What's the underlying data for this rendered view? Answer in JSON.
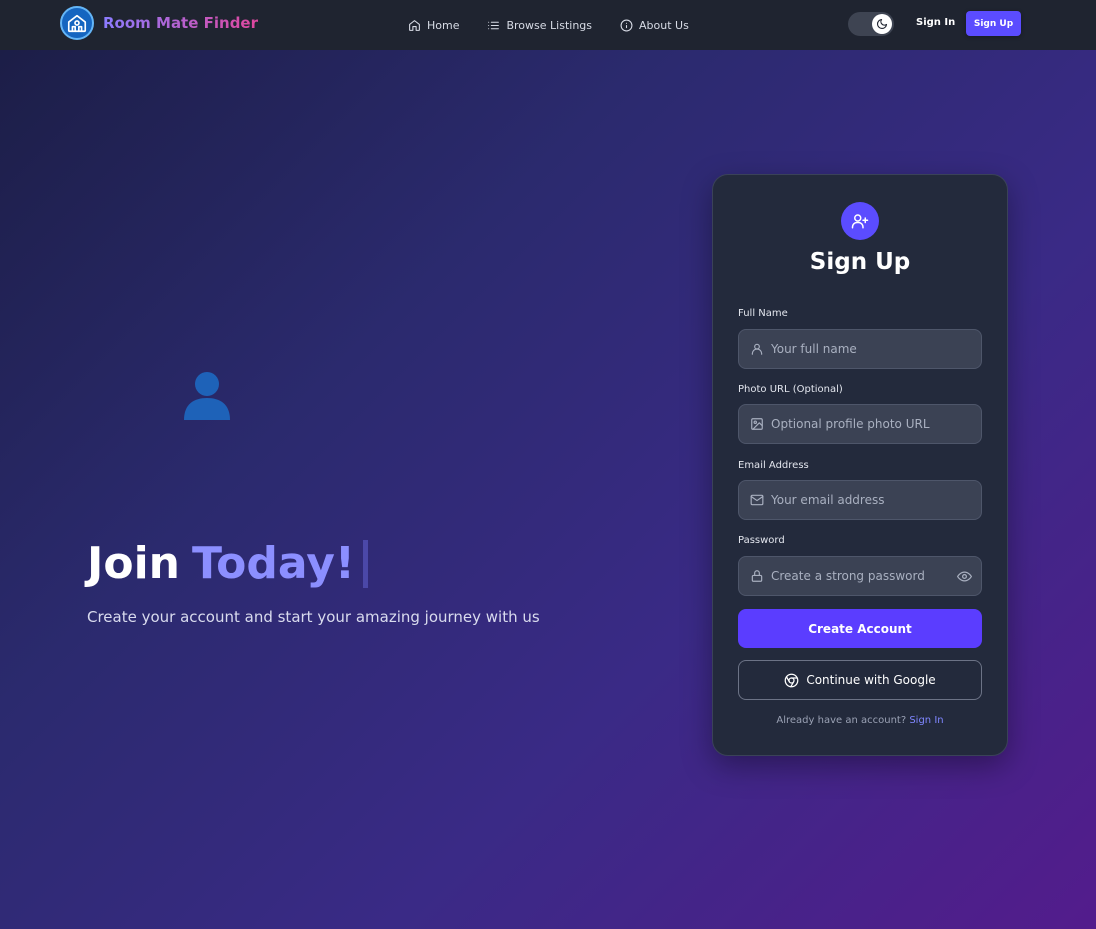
{
  "nav": {
    "brand": "Room Mate Finder",
    "links": [
      {
        "label": "Home",
        "icon": "home-icon"
      },
      {
        "label": "Browse Listings",
        "icon": "list-icon"
      },
      {
        "label": "About Us",
        "icon": "info-icon"
      }
    ],
    "theme_toggle_icon": "moon-icon",
    "signin_label": "Sign In",
    "signup_label": "Sign Up"
  },
  "hero": {
    "avatar_icon": "user-avatar-icon",
    "title_part1": "Join",
    "title_part2": "Today!",
    "subtitle": "Create your account and start your amazing journey with us"
  },
  "form": {
    "title": "Sign Up",
    "header_icon": "user-plus-icon",
    "fields": [
      {
        "label": "Full Name",
        "placeholder": "Your full name",
        "icon": "user-icon",
        "value": ""
      },
      {
        "label": "Photo URL (Optional)",
        "placeholder": "Optional profile photo URL",
        "icon": "image-icon",
        "value": ""
      },
      {
        "label": "Email Address",
        "placeholder": "Your email address",
        "icon": "mail-icon",
        "value": ""
      },
      {
        "label": "Password",
        "placeholder": "Create a strong password",
        "icon": "lock-icon",
        "value": ""
      }
    ],
    "create_label": "Create Account",
    "google_label": "Continue with Google",
    "already_text": "Already have an account?",
    "signin_link": "Sign In"
  },
  "colors": {
    "accent": "#5b4cff",
    "brand_gradient_start": "#8b7cff",
    "brand_gradient_end": "#e0479e",
    "title_highlight": "#8c8fff",
    "card_bg": "#232a3c"
  }
}
